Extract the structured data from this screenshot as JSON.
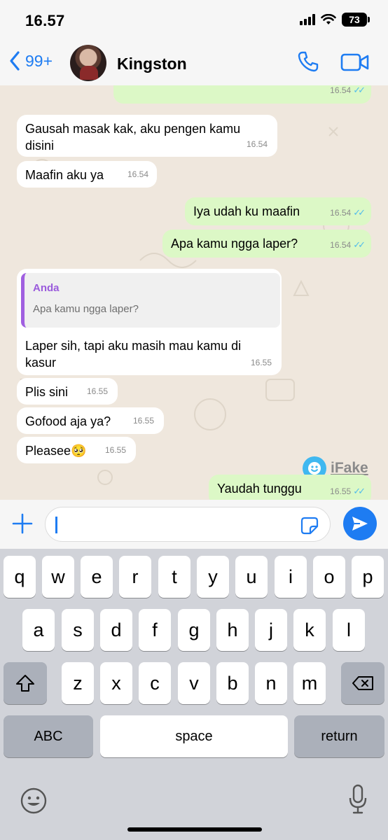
{
  "status_bar": {
    "time": "16.57",
    "battery": "73"
  },
  "header": {
    "back_count": "99+",
    "contact_name": "Kingston"
  },
  "messages": [
    {
      "text": "",
      "time": "16.54"
    },
    {
      "text": "Gausah masak kak, aku pengen kamu disini",
      "time": "16.54"
    },
    {
      "text": "Maafin aku ya",
      "time": "16.54"
    },
    {
      "text": "Iya udah ku maafin",
      "time": "16.54"
    },
    {
      "text": "Apa kamu ngga laper?",
      "time": "16.54"
    },
    {
      "text": "Laper sih, tapi aku masih mau kamu di kasur",
      "time": "16.55",
      "quote": {
        "author": "Anda",
        "text": "Apa kamu ngga laper?"
      }
    },
    {
      "text": "Plis sini",
      "time": "16.55"
    },
    {
      "text": "Gofood aja ya?",
      "time": "16.55"
    },
    {
      "text": "Pleasee🥺",
      "time": "16.55"
    },
    {
      "text": "Yaudah tunggu",
      "time": "16.55"
    }
  ],
  "watermark": {
    "text": "iFake"
  },
  "keyboard": {
    "row1": [
      "q",
      "w",
      "e",
      "r",
      "t",
      "y",
      "u",
      "i",
      "o",
      "p"
    ],
    "row2": [
      "a",
      "s",
      "d",
      "f",
      "g",
      "h",
      "j",
      "k",
      "l"
    ],
    "row3": [
      "z",
      "x",
      "c",
      "v",
      "b",
      "n",
      "m"
    ],
    "abc": "ABC",
    "space": "space",
    "return": "return"
  },
  "colors": {
    "accent": "#1e7cf2",
    "outgoing_bubble": "#dcf8c6",
    "incoming_bubble": "#ffffff",
    "chat_background": "#efe7dd",
    "read_ticks": "#53bdeb"
  }
}
